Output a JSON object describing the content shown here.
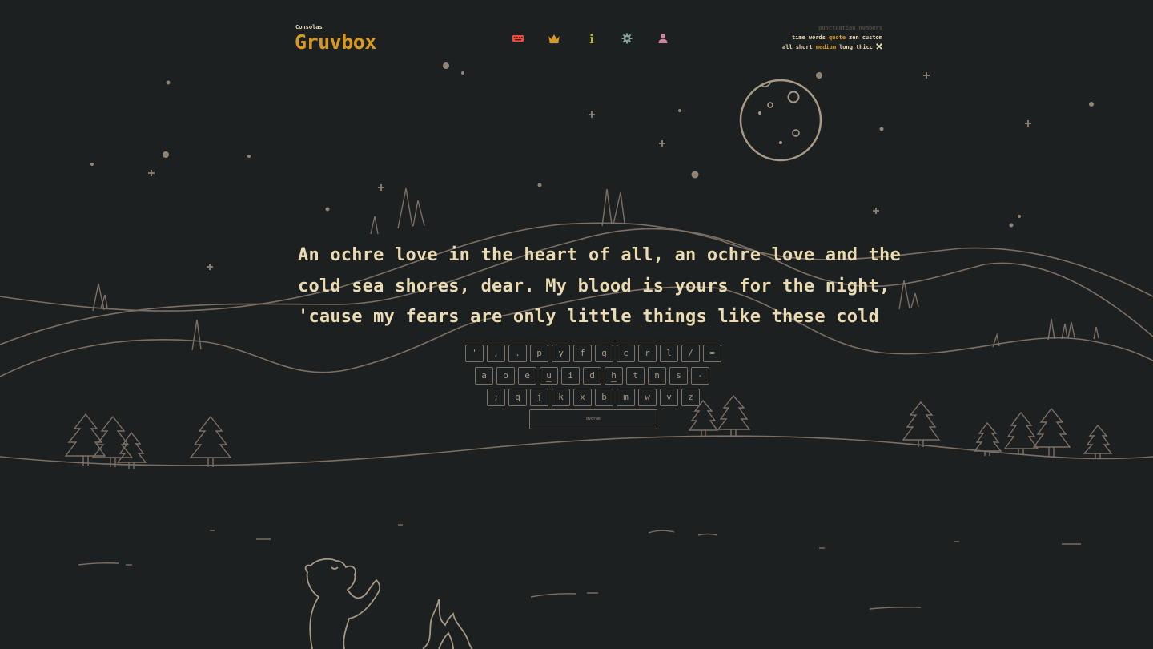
{
  "header": {
    "font_name": "Consolas",
    "theme_name": "Gruvbox",
    "nav": [
      {
        "name": "keyboard-icon",
        "color": "#fb4934"
      },
      {
        "name": "crown-icon",
        "color": "#d79921"
      },
      {
        "name": "info-icon",
        "color": "#b8bb26"
      },
      {
        "name": "gear-icon",
        "color": "#83a598"
      },
      {
        "name": "user-icon",
        "color": "#d3869b"
      }
    ]
  },
  "modes": {
    "punctuation": "punctuation",
    "numbers": "numbers",
    "time": "time",
    "words": "words",
    "quote": "quote",
    "zen": "zen",
    "custom": "custom",
    "all": "all",
    "short": "short",
    "medium": "medium",
    "long": "long",
    "thicc": "thicc",
    "tools_icon": "tools-icon"
  },
  "quote": {
    "line1": "An ochre love in the heart of all, an ochre love and the",
    "line2": "cold sea shores, dear. My blood is yours for the night,",
    "line3": "'cause my fears are only little things like these cold"
  },
  "keyboard": {
    "rows": [
      [
        "'",
        ",",
        ".",
        "p",
        "y",
        "f",
        "g",
        "c",
        "r",
        "l",
        "/",
        "="
      ],
      [
        "a",
        "o",
        "e",
        "u",
        "i",
        "d",
        "h",
        "t",
        "n",
        "s",
        "-"
      ],
      [
        ";",
        "q",
        "j",
        "k",
        "x",
        "b",
        "m",
        "w",
        "v",
        "z"
      ]
    ],
    "bump_keys": [
      "u",
      "h"
    ],
    "layout_name": "dvorak"
  },
  "colors": {
    "background": "#1d2021",
    "text": "#ebdbb2",
    "accent": "#d79921",
    "line_art": "#a89984",
    "dim": "#504945"
  }
}
